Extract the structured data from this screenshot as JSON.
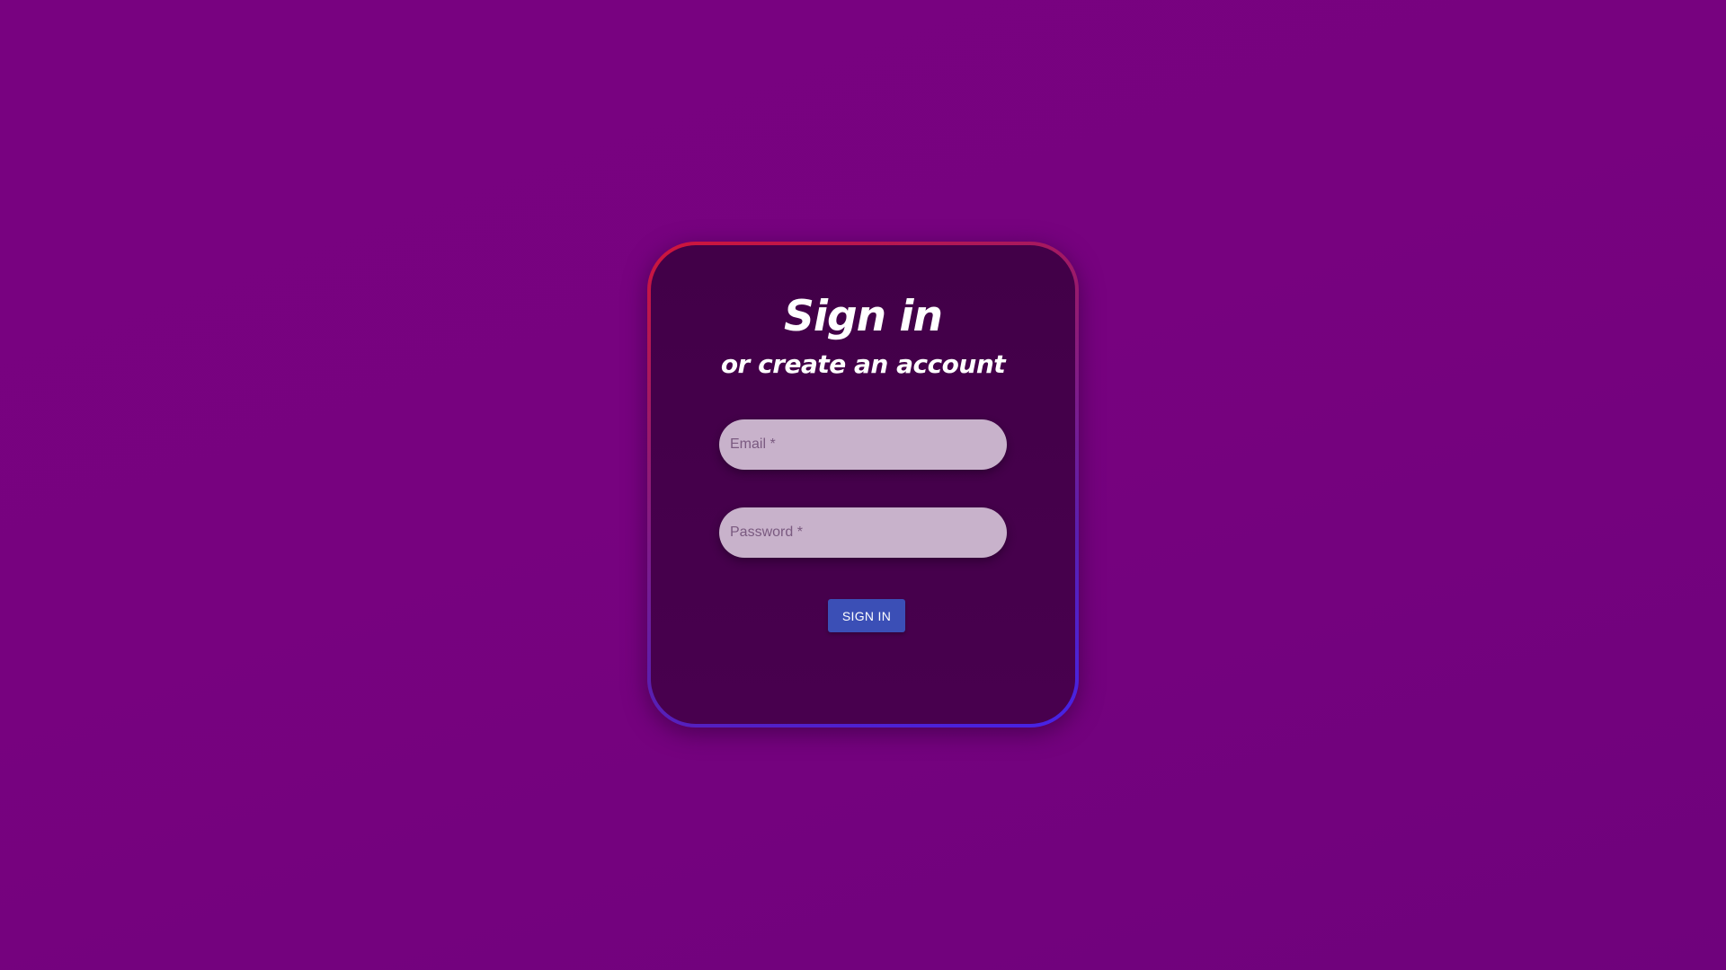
{
  "form": {
    "title": "Sign in",
    "subtitle": "or create an account",
    "email": {
      "placeholder": "Email *",
      "value": ""
    },
    "password": {
      "placeholder": "Password *",
      "value": ""
    },
    "submit_label": "SIGN IN"
  },
  "colors": {
    "background": "#780280",
    "card": "#440049",
    "border_start": "#d0153a",
    "border_end": "#4623e8",
    "input": "#c8b2cb",
    "button": "#3b4fb6"
  }
}
